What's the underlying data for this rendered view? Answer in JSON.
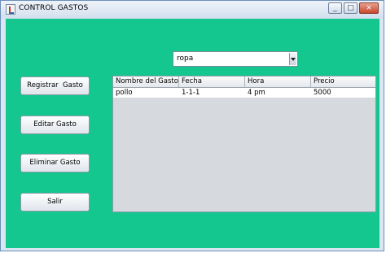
{
  "window": {
    "title": "CONTROL GASTOS"
  },
  "combo": {
    "value": "ropa"
  },
  "buttons": {
    "registrar": "Registrar  Gasto",
    "editar": "Editar Gasto",
    "eliminar": "Eliminar Gasto",
    "salir": "Salir"
  },
  "table": {
    "headers": [
      "Nombre del Gasto",
      "Fecha",
      "Hora",
      "Precio"
    ],
    "rows": [
      [
        "pollo",
        "1-1-1",
        "4 pm",
        "5000"
      ]
    ]
  },
  "colors": {
    "background": "#13c78f"
  }
}
